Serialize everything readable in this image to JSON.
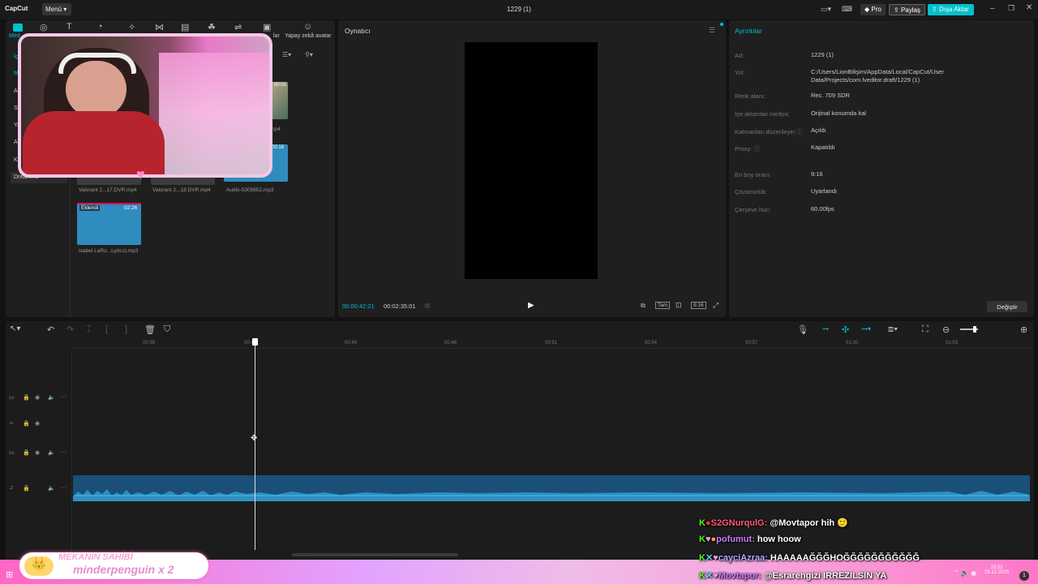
{
  "app": {
    "logo": "CapCut",
    "menu_label": "Menü",
    "window_title": "1229 (1)"
  },
  "titlebar": {
    "pro": "Pro",
    "share": "Paylaş",
    "export": "Dışa Aktar"
  },
  "toolbar": {
    "ai_avatar": "Yapay zekâ avatar",
    "tab_partial": "lar",
    "media_tab": "Med"
  },
  "media": {
    "sidebar": [
      "İç",
      "M",
      "A",
      "St",
      "Ya",
      "A",
      "Ki",
      "Dreamina"
    ],
    "items": [
      {
        "name": "Valorant 2...17.DVR.mp4",
        "duration": ""
      },
      {
        "name": "Valorant 2...18.DVR.mp4",
        "duration": ""
      },
      {
        "name": "Audio-5305652.mp3",
        "duration": "00:18"
      },
      {
        "name": "Isabel LaRo...Lyrics).mp3",
        "duration": "02:26",
        "badge": "Eklendi"
      }
    ],
    "partial_items": [
      {
        "name": "mp4",
        "duration": "00:01"
      }
    ]
  },
  "player": {
    "title": "Oynatıcı",
    "current_time": "00:00:42:21",
    "total_time": "00:02:35:01",
    "fit_label": "Tam",
    "ratio_label": "9:16"
  },
  "details": {
    "title": "Ayrıntılar",
    "rows": [
      {
        "label": "Ad:",
        "value": "1229 (1)"
      },
      {
        "label": "Yol:",
        "value": "C:/Users/LionBilişim/AppData/Local/CapCut/User Data/Projects/com.lveditor.draft/1229 (1)"
      },
      {
        "label": "Renk alanı:",
        "value": "Rec. 709 SDR"
      },
      {
        "label": "İçe aktarılan medya:",
        "value": "Orijinal konumda kal"
      },
      {
        "label": "Katmanları düzenleyin",
        "value": "Açıldı"
      },
      {
        "label": "Proxy:",
        "value": "Kapatıldı"
      },
      {
        "label": "En boy oranı:",
        "value": "9:16"
      },
      {
        "label": "Çözünürlük:",
        "value": "Uyarlandı"
      },
      {
        "label": "Çerçeve hızı:",
        "value": "60.00fps"
      }
    ],
    "modify_button": "Değiştir"
  },
  "timeline": {
    "ruler": [
      "00:39",
      "00:42",
      "00:45",
      "00:48",
      "00:51",
      "00:54",
      "00:57",
      "01:00",
      "01:03"
    ],
    "playhead_time": "00:42"
  },
  "overlay": {
    "chat": [
      {
        "user": "S2GNurqulG:",
        "user_color": "#ff5a7a",
        "message": "@Movtapor hih 🙂"
      },
      {
        "user": "pofumut:",
        "user_color": "#c77dff",
        "message": "how hoow"
      },
      {
        "user": "cayciAzraa:",
        "user_color": "#b6a9ff",
        "message": "HAAAAAĞĞĞHOĞĞĞĞĞĞĞĞĞĞĞ"
      },
      {
        "user": "Movtapor:",
        "user_color": "#c77dff",
        "message": "@Esrarengizi IRREZILSIN YA"
      }
    ],
    "banner_line1": "MEKANIN SAHİBİ",
    "banner_line2": "minderpenguin x 2"
  },
  "taskbar": {
    "time": "23:52",
    "date": "29.12.2025",
    "notif_count": "1"
  }
}
